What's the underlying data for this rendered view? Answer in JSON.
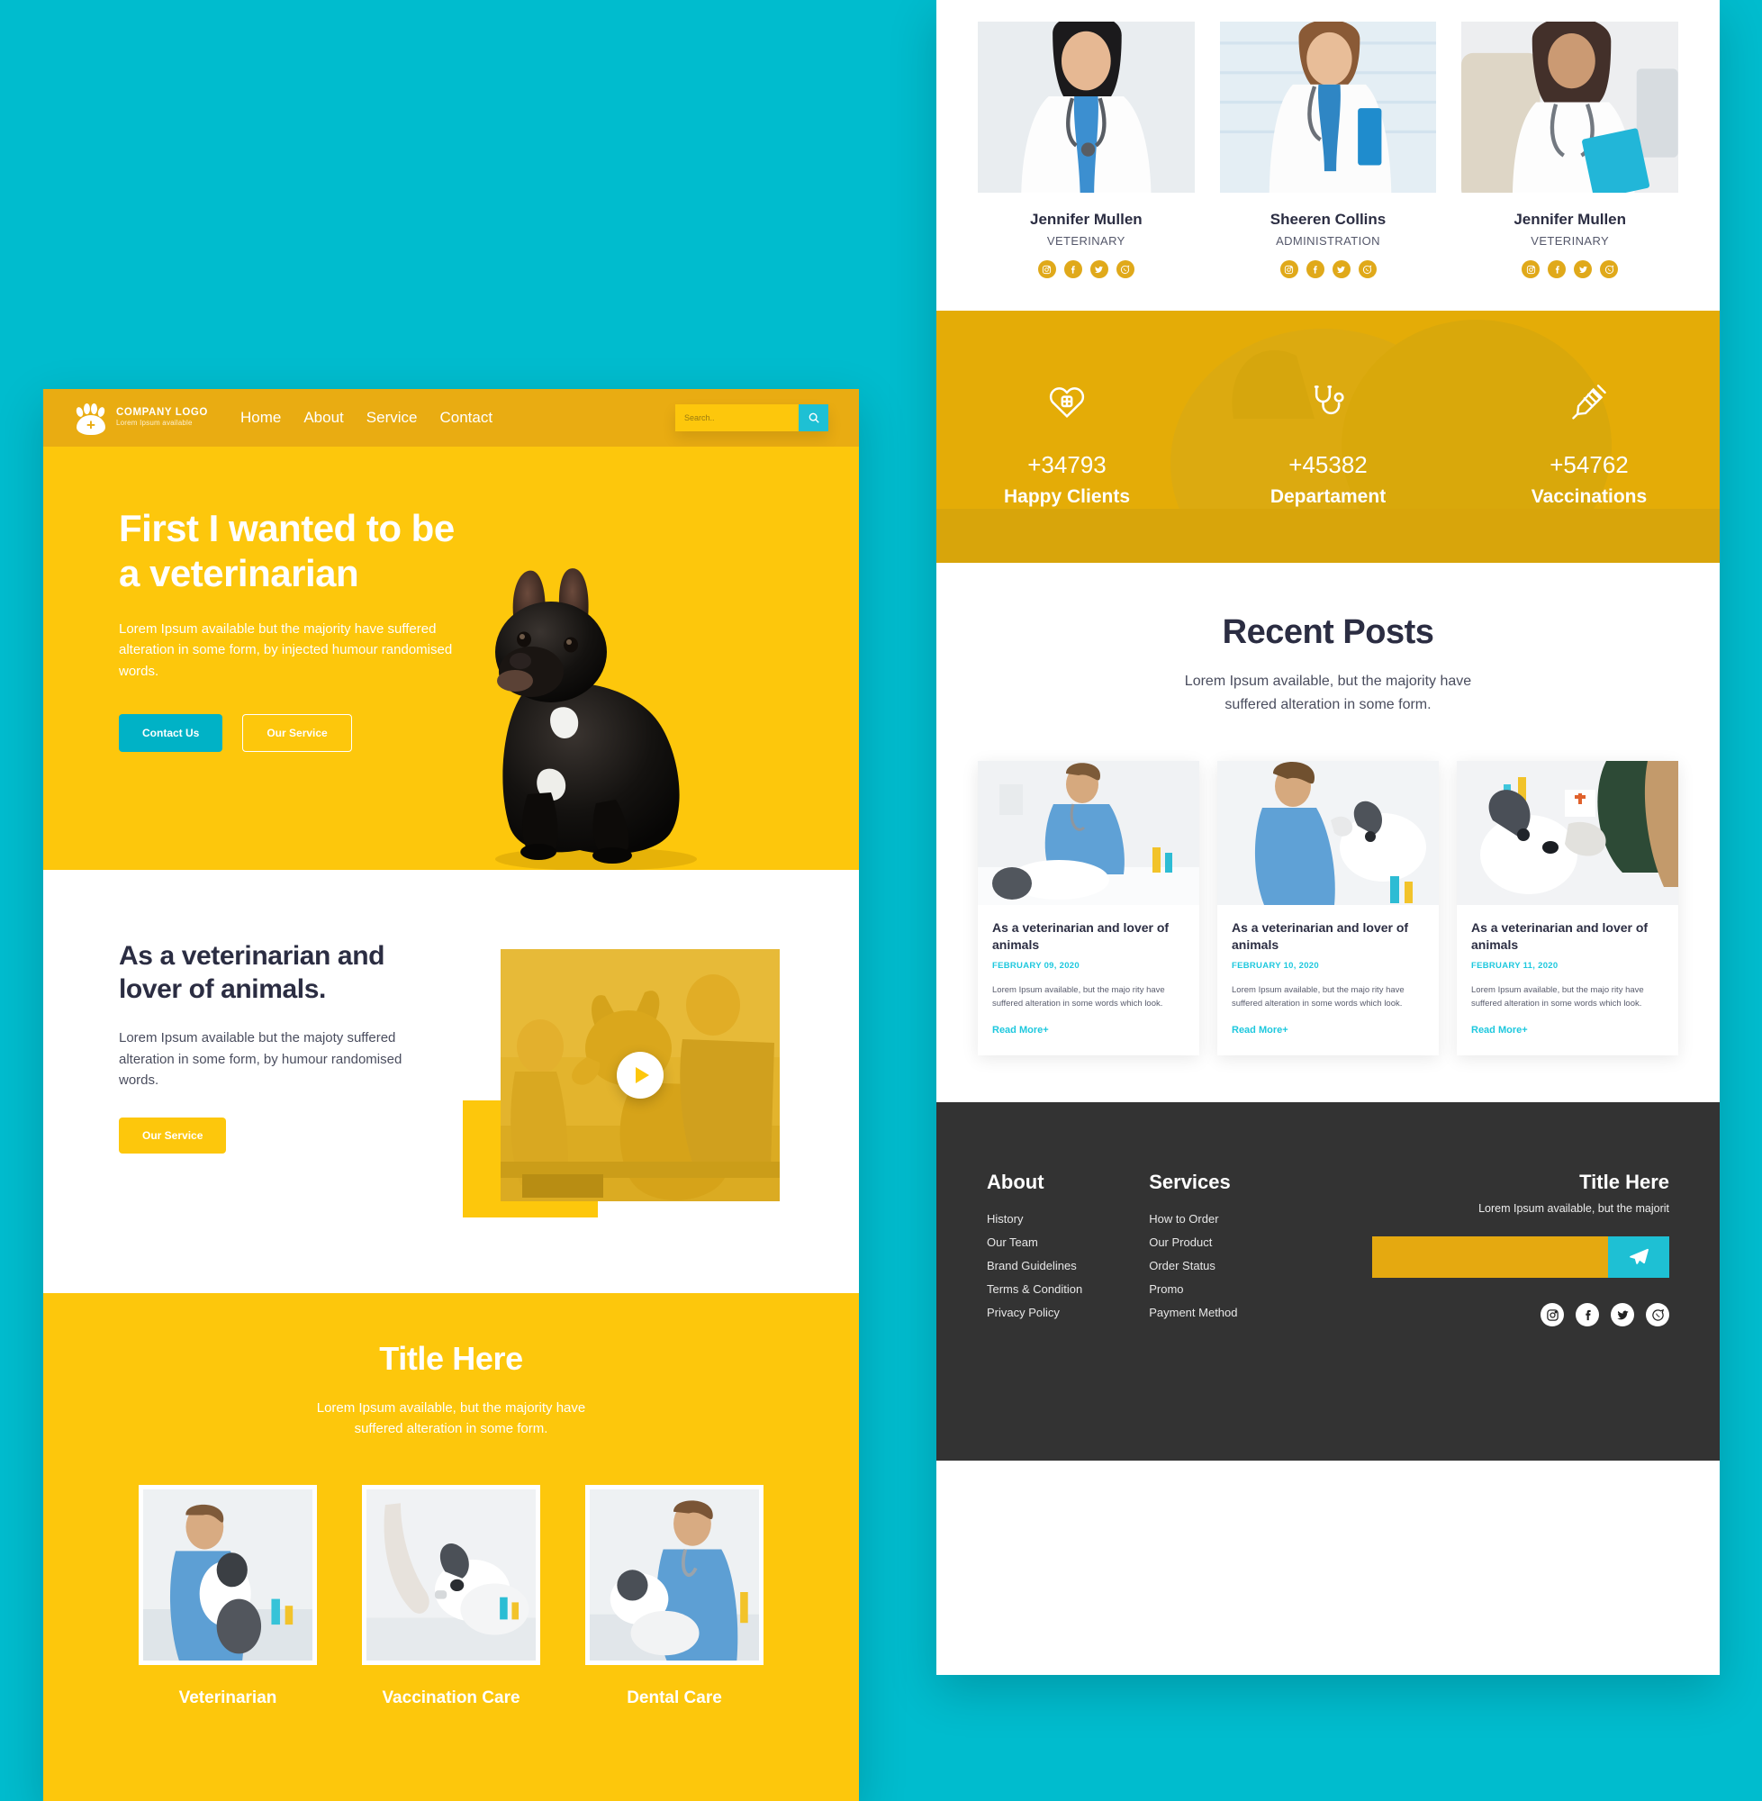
{
  "brand": {
    "accent_yellow": "#fdc70c",
    "accent_yellow_dark": "#e9ac12",
    "accent_teal": "#00bcce",
    "dark": "#2b2d42",
    "logo_name": "COMPANY LOGO",
    "logo_tagline": "Lorem Ipsum available",
    "logo_icon": "paw-print-icon"
  },
  "nav": {
    "links": [
      "Home",
      "About",
      "Service",
      "Contact"
    ],
    "search_placeholder": "Search..",
    "search_value": "",
    "search_icon": "magnifier-icon"
  },
  "hero": {
    "title_line1": "First I wanted to be",
    "title_line2": "a veterinarian",
    "paragraph": "Lorem Ipsum available but the majority have suffered alteration in some form, by injected humour randomised words.",
    "primary_btn": "Contact Us",
    "secondary_btn": "Our Service",
    "image_alt": "black-french-bulldog-photo"
  },
  "about": {
    "title_line1": "As a veterinarian and",
    "title_line2": "lover of animals.",
    "paragraph": "Lorem Ipsum available but the majoty suffered alteration in some form, by humour randomised words.",
    "btn": "Our Service",
    "video_icon": "play-button-icon",
    "video_alt": "vet-and-german-shepherd-video-thumbnail"
  },
  "services": {
    "title": "Title Here",
    "subtitle_line1": "Lorem Ipsum available, but the majority have",
    "subtitle_line2": "suffered alteration in some form.",
    "cards": [
      {
        "label": "Veterinarian",
        "image_alt": "vet-examining-border-collie"
      },
      {
        "label": "Vaccination Care",
        "image_alt": "gloved-hand-and-dog"
      },
      {
        "label": "Dental Care",
        "image_alt": "vet-with-stethoscope-and-dog"
      }
    ]
  },
  "team": {
    "members": [
      {
        "name": "Jennifer Mullen",
        "role": "VETERINARY",
        "image_alt": "doctor-portrait-1"
      },
      {
        "name": "Sheeren Collins",
        "role": "ADMINISTRATION",
        "image_alt": "doctor-portrait-2"
      },
      {
        "name": "Jennifer Mullen",
        "role": "VETERINARY",
        "image_alt": "doctor-portrait-3"
      }
    ],
    "social_icons": [
      "instagram-icon",
      "facebook-icon",
      "twitter-icon",
      "whatsapp-icon"
    ]
  },
  "stats": {
    "items": [
      {
        "icon": "heart-with-cross-icon",
        "number": "+34793",
        "label": "Happy Clients"
      },
      {
        "icon": "stethoscope-icon",
        "number": "+45382",
        "label": "Departament"
      },
      {
        "icon": "syringe-icon",
        "number": "+54762",
        "label": "Vaccinations"
      }
    ]
  },
  "posts": {
    "title": "Recent Posts",
    "subtitle_line1": "Lorem Ipsum available, but the majority have",
    "subtitle_line2": "suffered alteration in some form.",
    "items": [
      {
        "title": "As a veterinarian and lover of animals",
        "date": "FEBRUARY 09, 2020",
        "text": "Lorem Ipsum available, but the majo rity have suffered alteration in some words which look.",
        "more": "Read More+",
        "image_alt": "vet-treating-dog-on-table"
      },
      {
        "title": "As a veterinarian and lover of animals",
        "date": "FEBRUARY 10, 2020",
        "text": "Lorem Ipsum available, but the majo rity have suffered alteration in some words which look.",
        "more": "Read More+",
        "image_alt": "vet-petting-border-collie"
      },
      {
        "title": "As a veterinarian and lover of animals",
        "date": "FEBRUARY 11, 2020",
        "text": "Lorem Ipsum available, but the majo rity have suffered alteration in some words which look.",
        "more": "Read More+",
        "image_alt": "dog-being-examined"
      }
    ]
  },
  "footer": {
    "about_heading": "About",
    "about_links": [
      "History",
      "Our Team",
      "Brand Guidelines",
      "Terms & Condition",
      "Privacy Policy"
    ],
    "services_heading": "Services",
    "services_links": [
      "How to Order",
      "Our Product",
      "Order Status",
      "Promo",
      "Payment Method"
    ],
    "newsletter_title": "Title Here",
    "newsletter_text": "Lorem Ipsum available, but the majorit",
    "newsletter_placeholder": "",
    "newsletter_value": "",
    "send_icon": "paper-plane-icon",
    "social_icons": [
      "instagram-icon",
      "facebook-icon",
      "twitter-icon",
      "whatsapp-icon"
    ]
  }
}
